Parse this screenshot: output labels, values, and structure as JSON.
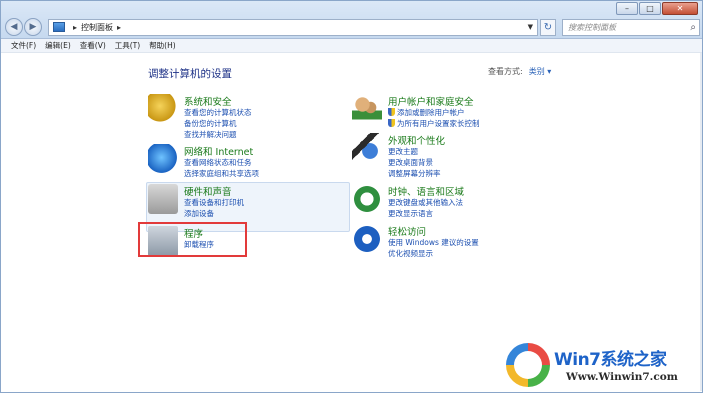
{
  "address": {
    "crumbs": [
      "控制面板"
    ],
    "search_placeholder": "搜索控制面板"
  },
  "caption": {
    "minimize": "–",
    "maximize": "□",
    "close": "✕"
  },
  "menu": [
    "文件(F)",
    "编辑(E)",
    "查看(V)",
    "工具(T)",
    "帮助(H)"
  ],
  "main": {
    "heading": "调整计算机的设置",
    "view_by_label": "查看方式:",
    "view_by_value": "类别 ▾"
  },
  "categories": [
    {
      "icon": "shield-icon",
      "title": "系统和安全",
      "links": [
        "查看您的计算机状态",
        "备份您的计算机",
        "查找并解决问题"
      ]
    },
    {
      "icon": "globe-network-icon",
      "title": "网络和 Internet",
      "links": [
        "查看网络状态和任务",
        "选择家庭组和共享选项"
      ]
    },
    {
      "icon": "printer-icon",
      "title": "硬件和声音",
      "links": [
        "查看设备和打印机",
        "添加设备"
      ]
    },
    {
      "icon": "programs-icon",
      "title": "程序",
      "links": [
        "卸载程序"
      ]
    },
    {
      "icon": "users-icon",
      "title": "用户帐户和家庭安全",
      "links": [
        "添加或删除用户帐户",
        "为所有用户设置家长控制"
      ]
    },
    {
      "icon": "paint-icon",
      "title": "外观和个性化",
      "links": [
        "更改主题",
        "更改桌面背景",
        "调整屏幕分辨率"
      ]
    },
    {
      "icon": "clock-globe-icon",
      "title": "时钟、语言和区域",
      "links": [
        "更改键盘或其他输入法",
        "更改显示语言"
      ]
    },
    {
      "icon": "ease-of-access-icon",
      "title": "轻松访问",
      "links": [
        "使用 Windows 建议的设置",
        "优化视频显示"
      ]
    }
  ],
  "watermark": {
    "text": "Win7系统之家",
    "url": "Www.Winwin7.com"
  }
}
